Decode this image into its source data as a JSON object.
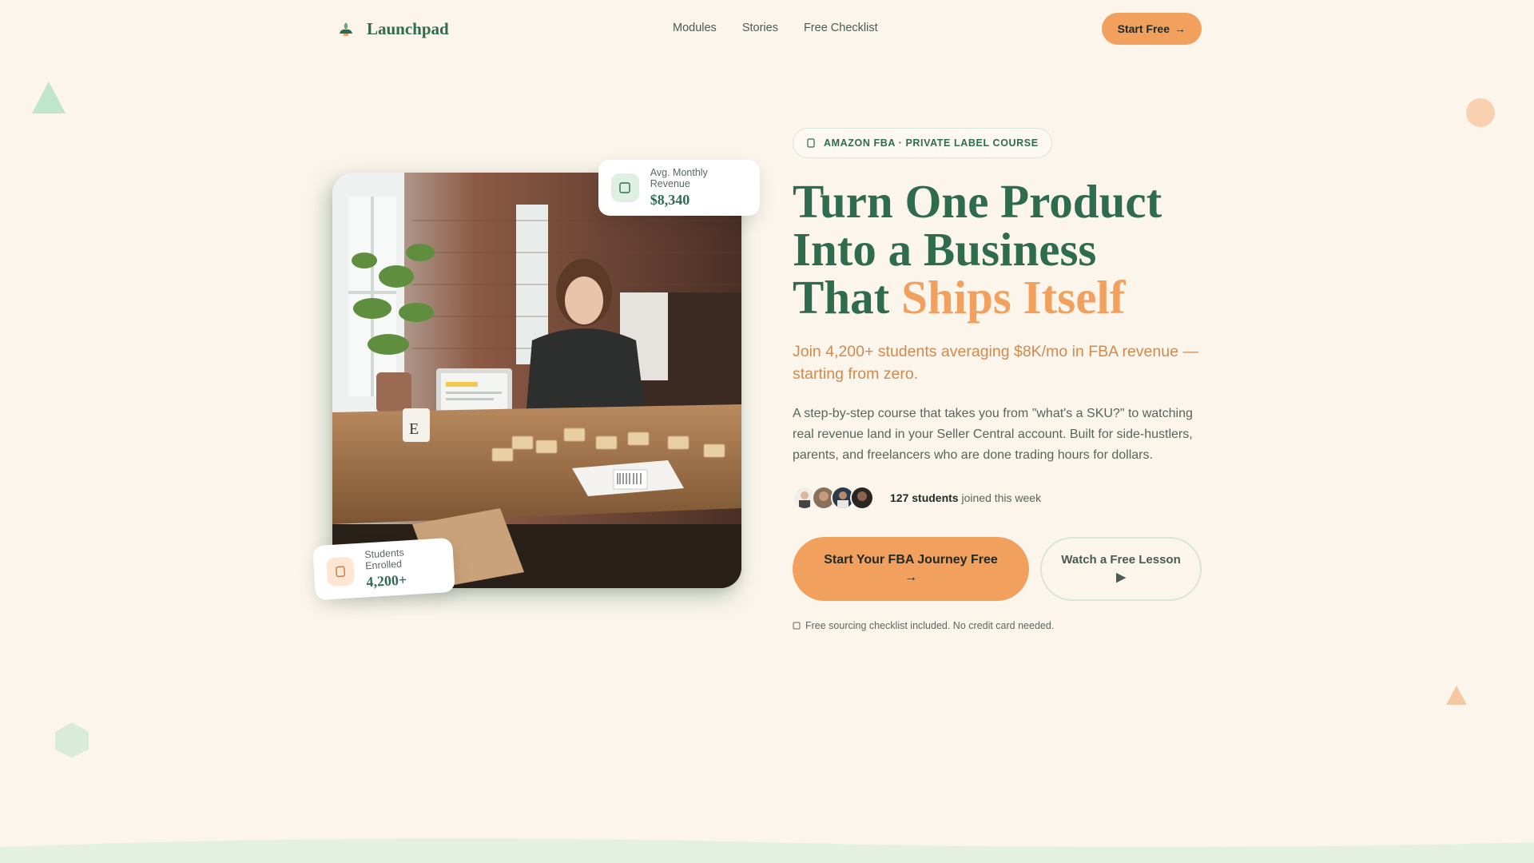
{
  "nav": {
    "brand": "Launchpad",
    "links": [
      "Modules",
      "Stories",
      "Free Checklist"
    ],
    "cta": "Start Free",
    "cta_arrow": "→"
  },
  "hero_image": {
    "revenue_card": {
      "label": "Avg. Monthly Revenue",
      "value": "$8,340",
      "icon": "chart-icon"
    },
    "students_card": {
      "label": "Students Enrolled",
      "value": "4,200+",
      "icon": "users-icon"
    }
  },
  "hero": {
    "badge": "AMAZON FBA · PRIVATE LABEL COURSE",
    "headline_line1": "Turn One Product",
    "headline_line2": "Into a Business",
    "headline_line3_plain": "That ",
    "headline_line3_accent": "Ships Itself",
    "subheadline": "Join 4,200+ students averaging $8K/mo in FBA revenue — starting from zero.",
    "description": "A step-by-step course that takes you from \"what's a SKU?\" to watching real revenue land in your Seller Central account. Built for side-hustlers, parents, and freelancers who are done trading hours for dollars.",
    "social_count": "127 students",
    "social_suffix": " joined this week",
    "primary_cta_line1": "Start Your FBA Journey Free",
    "primary_cta_line2": "→",
    "secondary_cta_line1": "Watch a Free Lesson",
    "secondary_cta_line2": "▶",
    "note": "Free sourcing checklist included. No credit card needed."
  },
  "colors": {
    "background": "#fcf5ec",
    "primary_green": "#2f6b50",
    "accent_orange": "#f2a05e"
  }
}
